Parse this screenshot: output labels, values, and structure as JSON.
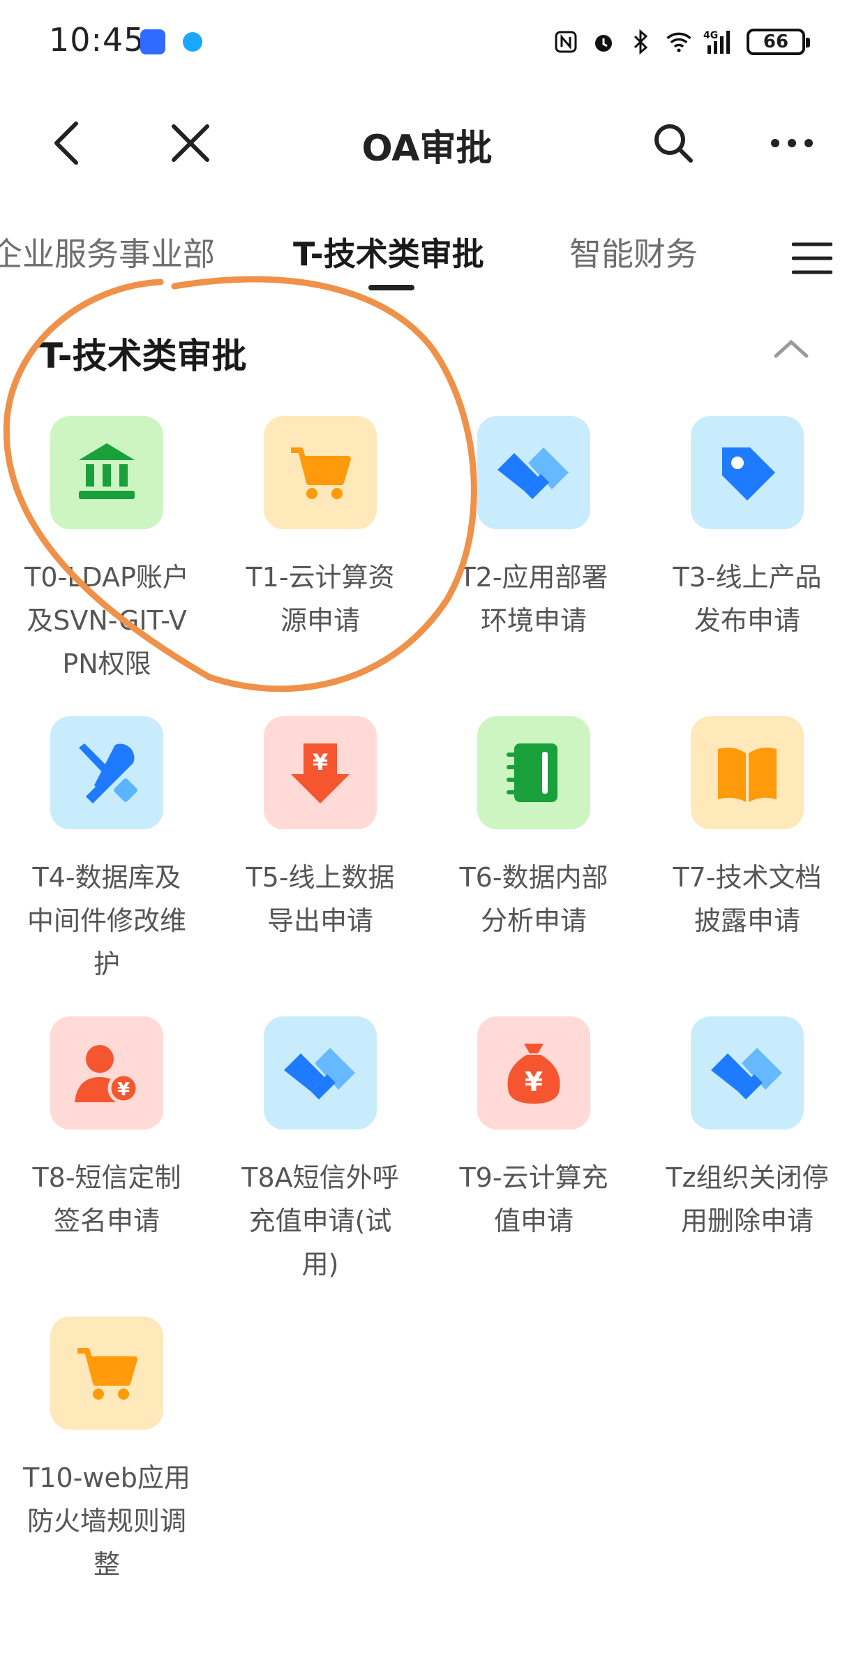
{
  "status": {
    "time": "10:45",
    "battery": "66",
    "network": "4G"
  },
  "nav": {
    "title": "OA审批"
  },
  "tabs": [
    {
      "label": "企业服务事业部"
    },
    {
      "label": "T-技术类审批",
      "active": true
    },
    {
      "label": "智能财务"
    }
  ],
  "section": {
    "title": "T-技术类审批"
  },
  "items": [
    {
      "label": "T0-LDAP账户及SVN-GIT-VPN权限",
      "icon": "bank-icon",
      "color": "green"
    },
    {
      "label": "T1-云计算资源申请",
      "icon": "cart-icon",
      "color": "orange"
    },
    {
      "label": "T2-应用部署环境申请",
      "icon": "handshake-icon",
      "color": "blue"
    },
    {
      "label": "T3-线上产品发布申请",
      "icon": "tag-icon",
      "color": "blue"
    },
    {
      "label": "T4-数据库及中间件修改维护",
      "icon": "tools-icon",
      "color": "blue"
    },
    {
      "label": "T5-线上数据导出申请",
      "icon": "yuan-download-icon",
      "color": "red"
    },
    {
      "label": "T6-数据内部分析申请",
      "icon": "notebook-icon",
      "color": "green"
    },
    {
      "label": "T7-技术文档披露申请",
      "icon": "book-icon",
      "color": "orange"
    },
    {
      "label": "T8-短信定制签名申请",
      "icon": "user-yuan-icon",
      "color": "red"
    },
    {
      "label": "T8A短信外呼充值申请(试用)",
      "icon": "handshake-icon",
      "color": "blue"
    },
    {
      "label": "T9-云计算充值申请",
      "icon": "money-bag-icon",
      "color": "red"
    },
    {
      "label": "Tz组织关闭停用删除申请",
      "icon": "handshake-icon",
      "color": "blue"
    },
    {
      "label": "T10-web应用防火墙规则调整",
      "icon": "cart-icon",
      "color": "orange"
    }
  ],
  "colors": {
    "annotation": "#ef9148",
    "blue_icon": "#1e7bff",
    "green_icon": "#19a03a",
    "orange_icon": "#ff9a0a",
    "red_icon": "#f5562f"
  }
}
